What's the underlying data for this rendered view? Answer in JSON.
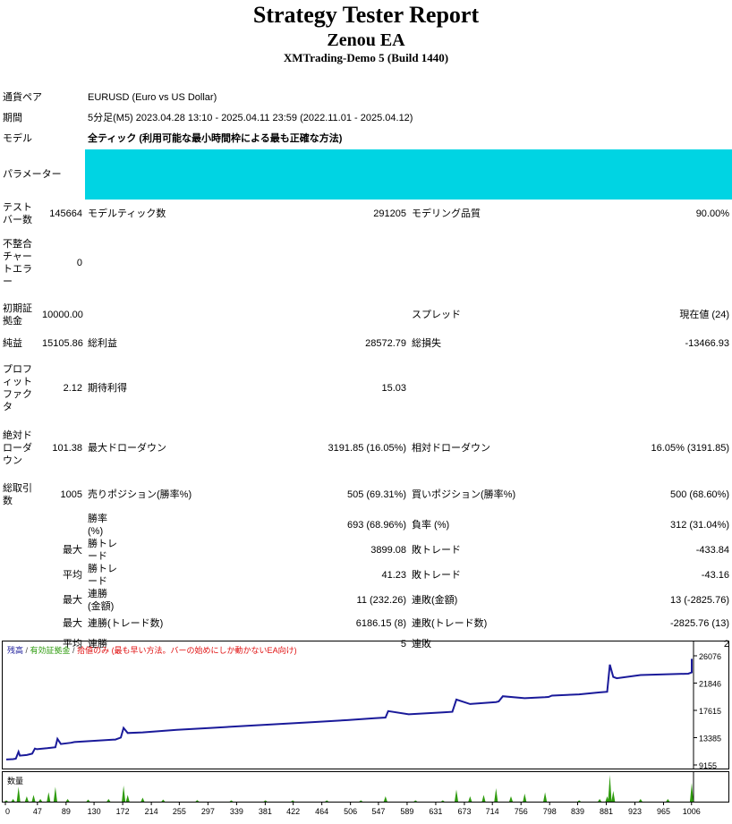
{
  "header": {
    "title": "Strategy Tester Report",
    "subtitle": "Zenou EA",
    "account": "XMTrading-Demo 5 (Build 1440)"
  },
  "report": {
    "symbol_label": "通貨ペア",
    "symbol_value": "EURUSD (Euro vs US Dollar)",
    "period_label": "期間",
    "period_value": "5分足(M5) 2023.04.28 13:10 - 2025.04.11 23:59 (2022.11.01 - 2025.04.12)",
    "model_label": "モデル",
    "model_value": "全ティック (利用可能な最小時間枠による最も正確な方法)",
    "params_label": "パラメーター",
    "bars_label": "テスト\nバー数",
    "bars_value": "145664",
    "ticks_label": "モデルティック数",
    "ticks_value": "291205",
    "quality_label": "モデリング品質",
    "quality_value": "90.00%",
    "mismatch_label": "不整合\nチャー\nトエラ\nー",
    "mismatch_value": "0",
    "deposit_label": "初期証\n拠金",
    "deposit_value": "10000.00",
    "spread_label": "スプレッド",
    "spread_value": "現在値 (24)",
    "net_label": "純益",
    "net_value": "15105.86",
    "gross_profit_label": "総利益",
    "gross_profit_value": "28572.79",
    "gross_loss_label": "総損失",
    "gross_loss_value": "-13466.93",
    "pf_label": "プロフ\nィット\nファク\nタ",
    "pf_value": "2.12",
    "expected_label": "期待利得",
    "expected_value": "15.03",
    "abs_dd_label": "絶対ド\nローダ\nウン",
    "abs_dd_value": "101.38",
    "max_dd_label": "最大ドローダウン",
    "max_dd_value": "3191.85 (16.05%)",
    "rel_dd_label": "相対ドローダウン",
    "rel_dd_value": "16.05% (3191.85)",
    "total_trades_label": "総取引\n数",
    "total_trades_value": "1005",
    "short_label": "売りポジション(勝率%)",
    "short_value": "505 (69.31%)",
    "long_label": "買いポジション(勝率%)",
    "long_value": "500 (68.60%)",
    "win_rate_label": "勝率(%)",
    "win_rate_value": "693 (68.96%)",
    "loss_rate_label": "負率 (%)",
    "loss_rate_value": "312 (31.04%)",
    "max_prefix": "最大",
    "avg_prefix": "平均",
    "largest_win_label": "勝トレード",
    "largest_win_value": "3899.08",
    "largest_loss_label": "敗トレード",
    "largest_loss_value": "-433.84",
    "avg_win_label": "勝トレード",
    "avg_win_value": "41.23",
    "avg_loss_label": "敗トレード",
    "avg_loss_value": "-43.16",
    "max_cons_win_label": "連勝(金額)",
    "max_cons_win_value": "11 (232.26)",
    "max_cons_loss_label": "連敗(金額)",
    "max_cons_loss_value": "13 (-2825.76)",
    "max_cons_profit_label": "連勝(トレード数)",
    "max_cons_profit_value": "6186.15 (8)",
    "max_cons_lossamt_label": "連敗(トレード数)",
    "max_cons_lossamt_value": "-2825.76 (13)",
    "avg_cons_win_label": "連勝",
    "avg_cons_win_value": "5",
    "avg_cons_loss_label": "連敗",
    "avg_cons_loss_value": "2"
  },
  "chart_legend": {
    "balance": "残高",
    "equity": "有効証拠金",
    "sep": " / ",
    "margin": "拾値のみ (最も早い方法。バーの始めにしか動かないEA向け)"
  },
  "volume_label": "数量",
  "colors": {
    "balance_line": "#1a1a9a",
    "volume_bars": "#2e9b0d",
    "params_fill": "#00d4e3"
  },
  "chart_data": {
    "type": "line",
    "title": "",
    "xlabel": "",
    "ylabel": "",
    "x_ticks": [
      0,
      47,
      89,
      130,
      172,
      214,
      255,
      297,
      339,
      381,
      422,
      464,
      506,
      547,
      589,
      631,
      673,
      714,
      756,
      798,
      839,
      881,
      923,
      965,
      1006
    ],
    "y_ticks": [
      9155,
      13385,
      17615,
      21846,
      26076
    ],
    "xlim": [
      0,
      1005
    ],
    "ylim": [
      9155,
      26076
    ],
    "grid": false,
    "series": [
      {
        "values_x": [
          0,
          10,
          14,
          18,
          20,
          30,
          38,
          42,
          45,
          60,
          72,
          75,
          80,
          95,
          100,
          160,
          168,
          172,
          178,
          200,
          250,
          300,
          350,
          400,
          450,
          500,
          540,
          556,
          560,
          590,
          640,
          654,
          660,
          680,
          718,
          722,
          728,
          760,
          790,
          795,
          800,
          840,
          870,
          881,
          885,
          890,
          895,
          930,
          1000,
          1005,
          1010,
          1020
        ],
        "values_y": [
          10000,
          10050,
          10120,
          11200,
          10600,
          10700,
          10900,
          11700,
          11600,
          11750,
          11900,
          13200,
          12400,
          12600,
          12700,
          13100,
          13400,
          14900,
          14100,
          14200,
          14600,
          14900,
          15200,
          15500,
          15800,
          16100,
          16400,
          16500,
          17500,
          17000,
          17300,
          17400,
          19300,
          18600,
          18900,
          19000,
          19800,
          19500,
          19650,
          19700,
          19900,
          20100,
          20400,
          20500,
          24700,
          22800,
          22600,
          23100,
          23300,
          23500,
          25600,
          25000
        ]
      }
    ],
    "volume": {
      "x": [
        0,
        10,
        18,
        30,
        40,
        50,
        62,
        72,
        90,
        120,
        150,
        172,
        178,
        200,
        230,
        280,
        330,
        380,
        420,
        470,
        520,
        556,
        600,
        640,
        660,
        680,
        700,
        718,
        740,
        760,
        790,
        840,
        870,
        881,
        885,
        890,
        930,
        970,
        1005,
        1010
      ],
      "y": [
        0.05,
        0.1,
        0.55,
        0.2,
        0.25,
        0.1,
        0.35,
        0.55,
        0.1,
        0.08,
        0.1,
        0.6,
        0.25,
        0.15,
        0.08,
        0.06,
        0.05,
        0.05,
        0.05,
        0.05,
        0.05,
        0.2,
        0.05,
        0.05,
        0.45,
        0.2,
        0.25,
        0.5,
        0.2,
        0.3,
        0.35,
        0.05,
        0.1,
        0.2,
        1.0,
        0.4,
        0.1,
        0.1,
        0.7,
        0.3
      ]
    }
  }
}
